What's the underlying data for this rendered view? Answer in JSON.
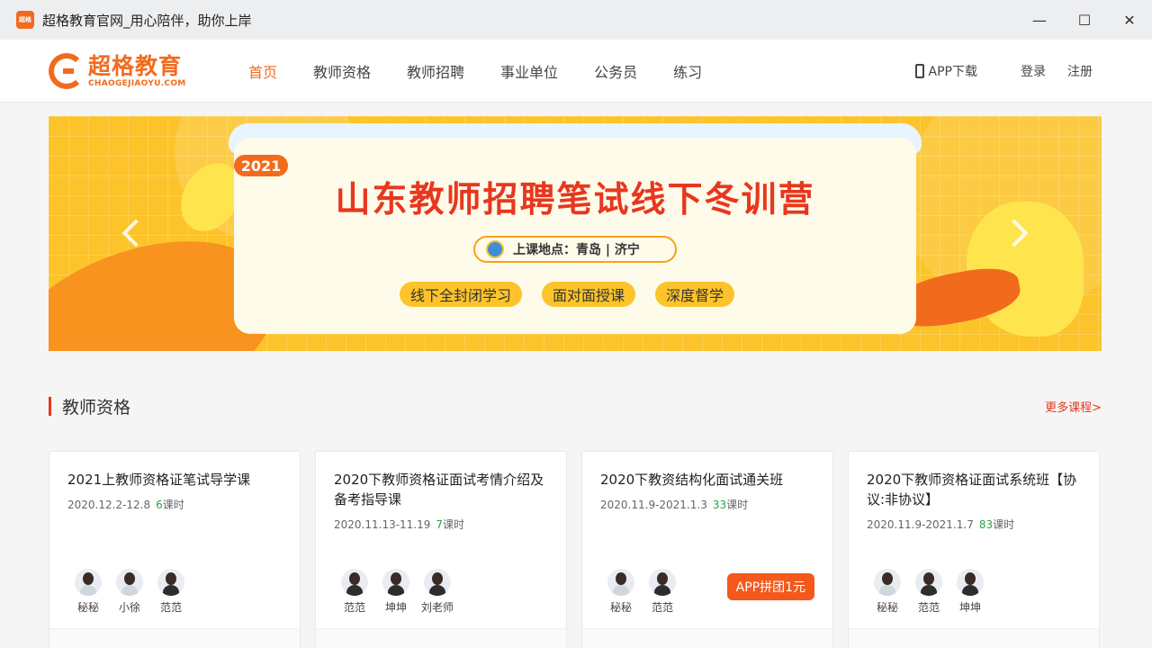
{
  "window": {
    "app_icon_text": "超格",
    "title": "超格教育官网_用心陪伴，助你上岸",
    "controls": {
      "minimize": "—",
      "maximize": "☐",
      "close": "✕"
    }
  },
  "header": {
    "logo_cn": "超格教育",
    "logo_en": "CHAOGEJIAOYU.COM",
    "nav": [
      "首页",
      "教师资格",
      "教师招聘",
      "事业单位",
      "公务员",
      "练习"
    ],
    "active_nav": "首页",
    "app_download": "APP下载",
    "login": "登录",
    "register": "注册"
  },
  "banner": {
    "year": "2021",
    "title": "山东教师招聘笔试线下冬训营",
    "location": "上课地点：青岛 | 济宁",
    "tags": [
      "线下全封闭学习",
      "面对面授课",
      "深度督学"
    ]
  },
  "section": {
    "title": "教师资格",
    "more": "更多课程>"
  },
  "courses": [
    {
      "title": "2021上教师资格证笔试导学课",
      "date": "2020.12.2-12.8",
      "count": "6",
      "unit": "课时",
      "teachers": [
        "秘秘",
        "小徐",
        "范范"
      ],
      "promo": ""
    },
    {
      "title": "2020下教师资格证面试考情介绍及备考指导课",
      "date": "2020.11.13-11.19",
      "count": "7",
      "unit": "课时",
      "teachers": [
        "范范",
        "坤坤",
        "刘老师"
      ],
      "promo": ""
    },
    {
      "title": "2020下教资结构化面试通关班",
      "date": "2020.11.9-2021.1.3",
      "count": "33",
      "unit": "课时",
      "teachers": [
        "秘秘",
        "范范"
      ],
      "promo": "APP拼团1元"
    },
    {
      "title": "2020下教师资格证面试系统班【协议:非协议】",
      "date": "2020.11.9-2021.1.7",
      "count": "83",
      "unit": "课时",
      "teachers": [
        "秘秘",
        "范范",
        "坤坤"
      ],
      "promo": ""
    }
  ]
}
